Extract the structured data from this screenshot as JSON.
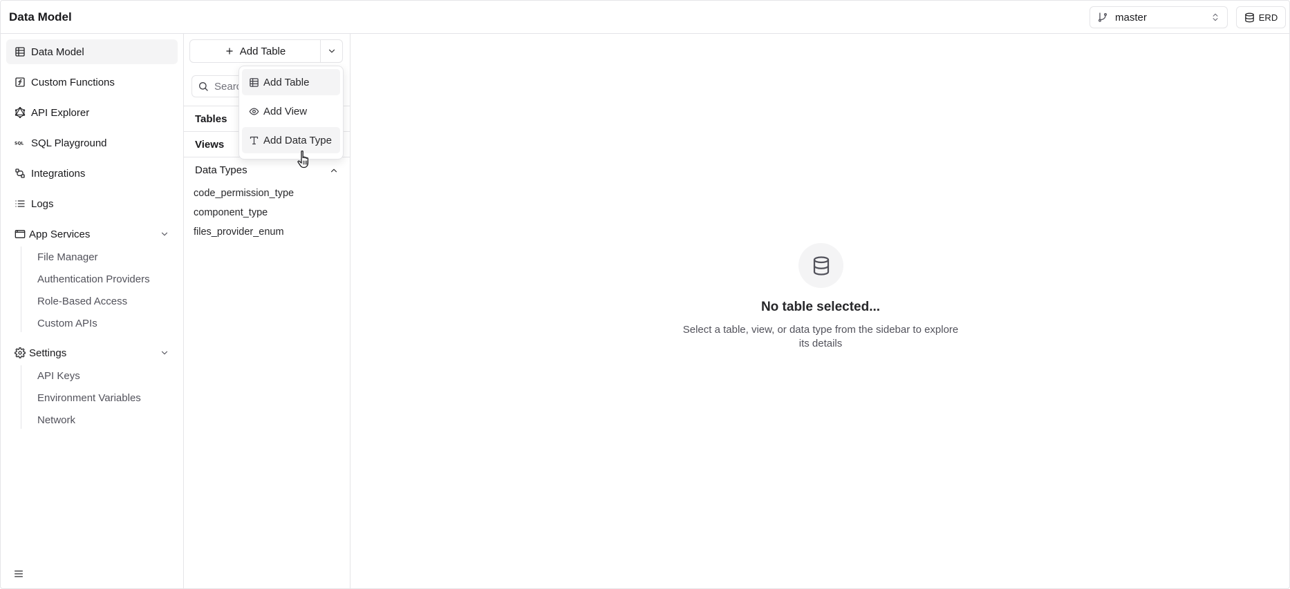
{
  "app": {
    "title": "Data Model"
  },
  "topbar": {
    "branch": {
      "value": "master",
      "icon": "git-branch-icon"
    },
    "erd_label": "ERD"
  },
  "sidebar": {
    "items": [
      {
        "label": "Data Model",
        "icon": "table-grid-icon",
        "active": true
      },
      {
        "label": "Custom Functions",
        "icon": "function-icon"
      },
      {
        "label": "API Explorer",
        "icon": "graphql-icon"
      },
      {
        "label": "SQL Playground",
        "icon": "sql-icon"
      },
      {
        "label": "Integrations",
        "icon": "integrations-icon"
      },
      {
        "label": "Logs",
        "icon": "list-icon"
      }
    ],
    "app_services": {
      "label": "App Services",
      "items": [
        "File Manager",
        "Authentication Providers",
        "Role-Based Access",
        "Custom APIs"
      ]
    },
    "settings": {
      "label": "Settings",
      "items": [
        "API Keys",
        "Environment Variables",
        "Network"
      ]
    }
  },
  "midpanel": {
    "add_table_label": "Add Table",
    "search_placeholder": "Search",
    "sections": {
      "tables": "Tables",
      "views": "Views",
      "data_types": "Data Types"
    },
    "data_types": [
      "code_permission_type",
      "component_type",
      "files_provider_enum"
    ]
  },
  "dropdown": {
    "items": [
      {
        "label": "Add Table",
        "icon": "table-grid-icon"
      },
      {
        "label": "Add View",
        "icon": "eye-icon"
      },
      {
        "label": "Add Data Type",
        "icon": "type-icon"
      }
    ]
  },
  "empty_state": {
    "title": "No table selected...",
    "description": "Select a table, view, or data type from the sidebar to explore its details"
  }
}
